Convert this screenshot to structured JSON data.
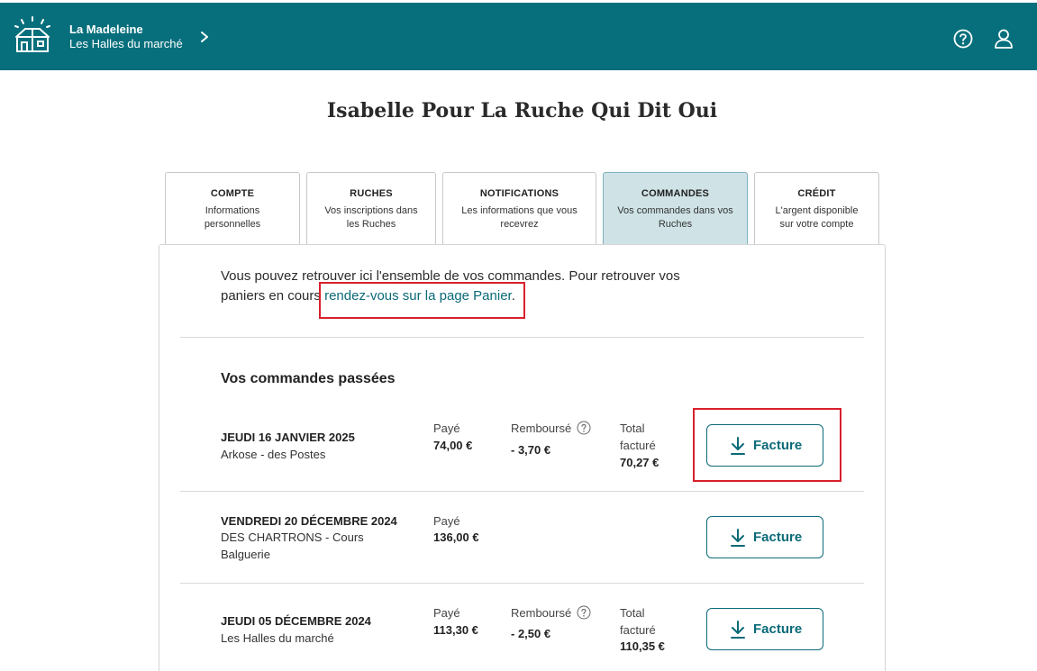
{
  "header": {
    "hive_name": "La Madeleine",
    "hive_location": "Les Halles du marché",
    "bar_color": "#076f7c",
    "icons": [
      "hive-logo-icon",
      "chevron-right-icon",
      "help-icon",
      "user-icon"
    ]
  },
  "page_title": "Isabelle Pour La Ruche Qui Dit Oui",
  "tabs": [
    {
      "title": "COMPTE",
      "desc": "Informations personnelles"
    },
    {
      "title": "RUCHES",
      "desc": "Vos inscriptions dans les Ruches"
    },
    {
      "title": "NOTIFICATIONS",
      "desc": "Les informations que vous recevrez"
    },
    {
      "title": "COMMANDES",
      "desc": "Vos commandes dans vos Ruches",
      "active": true
    },
    {
      "title": "CRÉDIT",
      "desc": "L'argent disponible sur votre compte"
    }
  ],
  "intro": {
    "text": "Vous pouvez retrouver ici l'ensemble de vos commandes. Pour retrouver vos paniers en cours",
    "link": "rendez-vous sur la page Panier",
    "end": "."
  },
  "orders_title": "Vos commandes passées",
  "labels": {
    "paid": "Payé",
    "refunded": "Remboursé",
    "total_line1": "Total",
    "total_line2": "facturé",
    "invoice": "Facture"
  },
  "orders": [
    {
      "date": "JEUDI 16 JANVIER 2025",
      "place": "Arkose - des Postes",
      "paid": "74,00 €",
      "refunded": "- 3,70 €",
      "total": "70,27 €"
    },
    {
      "date": "VENDREDI 20 DÉCEMBRE 2024",
      "place": "DES CHARTRONS - Cours Balguerie",
      "paid": "136,00 €"
    },
    {
      "date": "JEUDI 05 DÉCEMBRE 2024",
      "place": "Les Halles du marché",
      "paid": "113,30 €",
      "refunded": "- 2,50 €",
      "total": "110,35 €"
    }
  ],
  "colors": {
    "accent": "#0b6a78",
    "active_tab": "#cfe3e7",
    "highlight": "#d9202d"
  }
}
